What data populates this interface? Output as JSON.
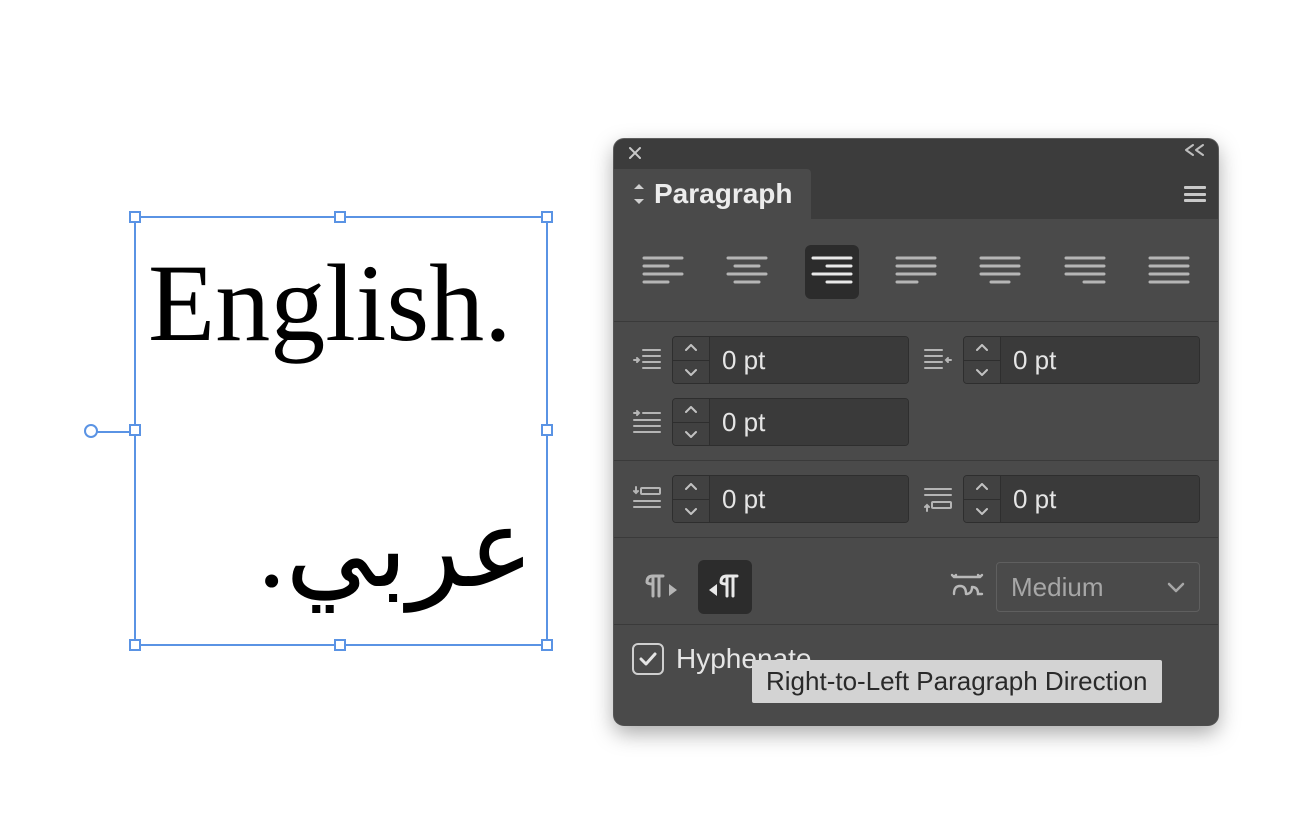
{
  "canvas": {
    "english_text": "English.",
    "arabic_text": "عربي."
  },
  "panel": {
    "tab_label": "Paragraph",
    "alignment_selected_index": 2,
    "indents": {
      "left": "0 pt",
      "right": "0 pt",
      "first_line": "0 pt",
      "space_before": "0 pt",
      "space_after": "0 pt"
    },
    "direction_selected": "rtl",
    "kashida": {
      "label": "Medium"
    },
    "hyphenate": {
      "label": "Hyphenate",
      "checked": true
    },
    "tooltip": "Right-to-Left Paragraph Direction"
  }
}
